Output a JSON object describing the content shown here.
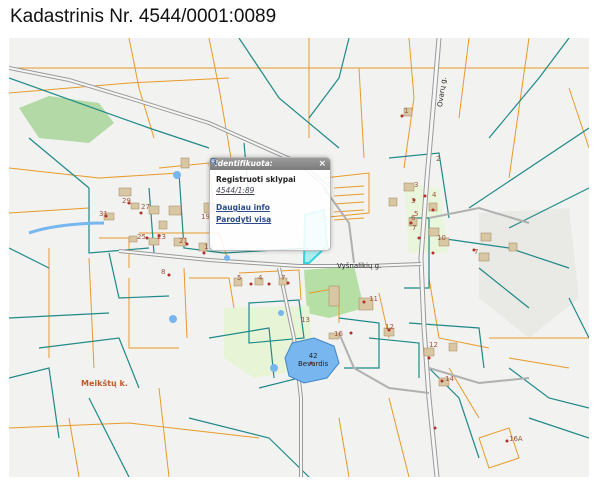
{
  "title": "Kadastrinis Nr. 4544/0001:0089",
  "popup": {
    "header": "Identifikuota:",
    "close": "×",
    "layer": "Registruoti sklypai",
    "parcel": "4544/1:89",
    "more_info": "Daugiau info",
    "show_all": "Parodyti visą"
  },
  "roads": {
    "ovaru": "Ovarų g.",
    "vysnuu": "Vyšnalikių g."
  },
  "village": "Meikštų k.",
  "lake": {
    "number": "42",
    "name": "Bevardis"
  },
  "house_numbers": [
    "1",
    "2",
    "3",
    "4",
    "5",
    "6",
    "7",
    "8",
    "10",
    "11",
    "12",
    "13",
    "14",
    "16",
    "16A",
    "19",
    "21",
    "23",
    "25",
    "27",
    "29",
    "31",
    "3",
    "5",
    "8",
    "7"
  ]
}
